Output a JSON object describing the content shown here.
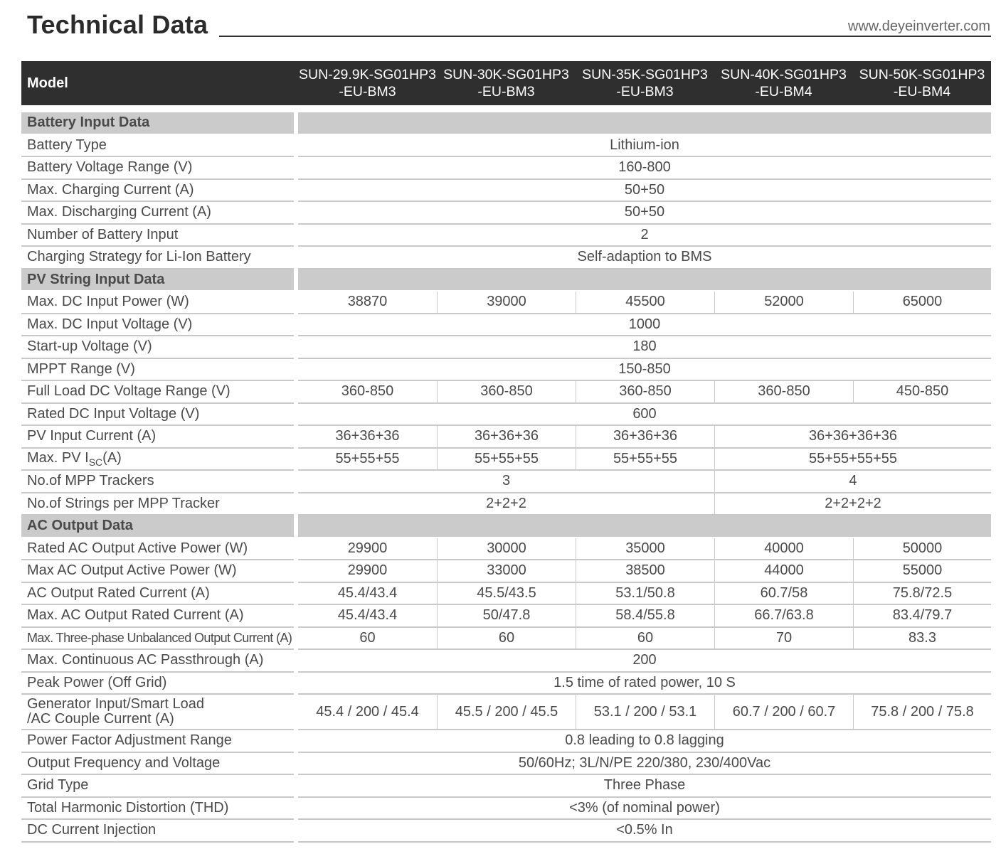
{
  "header": {
    "title": "Technical Data",
    "website": "www.deyeinverter.com"
  },
  "table": {
    "model_label": "Model",
    "models": [
      {
        "line1": "SUN-29.9K-SG01HP3",
        "line2": "-EU-BM3"
      },
      {
        "line1": "SUN-30K-SG01HP3",
        "line2": "-EU-BM3"
      },
      {
        "line1": "SUN-35K-SG01HP3",
        "line2": "-EU-BM3"
      },
      {
        "line1": "SUN-40K-SG01HP3",
        "line2": "-EU-BM4"
      },
      {
        "line1": "SUN-50K-SG01HP3",
        "line2": "-EU-BM4"
      }
    ],
    "battery": {
      "section": "Battery Input Data",
      "battery_type": {
        "label": "Battery Type",
        "value": "Lithium-ion"
      },
      "voltage_range": {
        "label": "Battery Voltage Range (V)",
        "value": "160-800"
      },
      "max_charging": {
        "label": "Max. Charging Current (A)",
        "value": "50+50"
      },
      "max_discharging": {
        "label": "Max. Discharging Current (A)",
        "value": "50+50"
      },
      "num_inputs": {
        "label": "Number of Battery Input",
        "value": "2"
      },
      "strategy": {
        "label": "Charging Strategy for Li-Ion Battery",
        "value": "Self-adaption to BMS"
      }
    },
    "pv": {
      "section": "PV String Input Data",
      "max_dc_power": {
        "label": "Max. DC Input Power (W)",
        "values": [
          "38870",
          "39000",
          "45500",
          "52000",
          "65000"
        ]
      },
      "max_dc_voltage": {
        "label": "Max. DC Input Voltage (V)",
        "value": "1000"
      },
      "startup_voltage": {
        "label": "Start-up Voltage (V)",
        "value": "180"
      },
      "mppt_range": {
        "label": "MPPT Range (V)",
        "value": "150-850"
      },
      "full_load_range": {
        "label": "Full Load DC Voltage Range (V)",
        "values": [
          "360-850",
          "360-850",
          "360-850",
          "360-850",
          "450-850"
        ]
      },
      "rated_dc_voltage": {
        "label": "Rated DC Input Voltage (V)",
        "value": "600"
      },
      "pv_current": {
        "label": "PV Input Current (A)",
        "values": [
          "36+36+36",
          "36+36+36",
          "36+36+36"
        ],
        "merged": "36+36+36+36"
      },
      "max_isc": {
        "label_main": "Max. PV I",
        "label_sub": "SC",
        "label_unit": "(A)",
        "values": [
          "55+55+55",
          "55+55+55",
          "55+55+55"
        ],
        "merged": "55+55+55+55"
      },
      "num_mppt": {
        "label": "No.of MPP Trackers",
        "group1": "3",
        "group2": "4"
      },
      "strings_per_mppt": {
        "label": "No.of Strings per MPP Tracker",
        "group1": "2+2+2",
        "group2": "2+2+2+2"
      }
    },
    "ac": {
      "section": "AC Output Data",
      "rated_active_power": {
        "label": "Rated AC Output Active Power (W)",
        "values": [
          "29900",
          "30000",
          "35000",
          "40000",
          "50000"
        ]
      },
      "max_active_power": {
        "label": "Max AC Output Active Power (W)",
        "values": [
          "29900",
          "33000",
          "38500",
          "44000",
          "55000"
        ]
      },
      "rated_current": {
        "label": "AC Output Rated Current (A)",
        "values": [
          "45.4/43.4",
          "45.5/43.5",
          "53.1/50.8",
          "60.7/58",
          "75.8/72.5"
        ]
      },
      "max_rated_current": {
        "label": "Max. AC Output Rated Current (A)",
        "values": [
          "45.4/43.4",
          "50/47.8",
          "58.4/55.8",
          "66.7/63.8",
          "83.4/79.7"
        ]
      },
      "unbalanced_current": {
        "label": "Max. Three-phase Unbalanced Output Current (A)",
        "values": [
          "60",
          "60",
          "60",
          "70",
          "83.3"
        ]
      },
      "passthrough": {
        "label": "Max. Continuous AC Passthrough (A)",
        "value": "200"
      },
      "peak_power": {
        "label": "Peak Power (Off Grid)",
        "value": "1.5 time of rated power, 10 S"
      },
      "generator": {
        "label_line1": "Generator Input/Smart Load",
        "label_line2": "/AC Couple Current (A)",
        "values": [
          "45.4 / 200 / 45.4",
          "45.5 / 200 / 45.5",
          "53.1 / 200 / 53.1",
          "60.7 / 200 / 60.7",
          "75.8 / 200 / 75.8"
        ]
      },
      "power_factor": {
        "label": "Power Factor Adjustment Range",
        "value": "0.8 leading to 0.8 lagging"
      },
      "freq_voltage": {
        "label": "Output Frequency and Voltage",
        "value": "50/60Hz; 3L/N/PE 220/380, 230/400Vac"
      },
      "grid_type": {
        "label": "Grid Type",
        "value": "Three Phase"
      },
      "thd": {
        "label": "Total Harmonic Distortion (THD)",
        "value": "<3% (of nominal power)"
      },
      "dc_injection": {
        "label": "DC Current Injection",
        "value": "<0.5% In"
      }
    }
  }
}
